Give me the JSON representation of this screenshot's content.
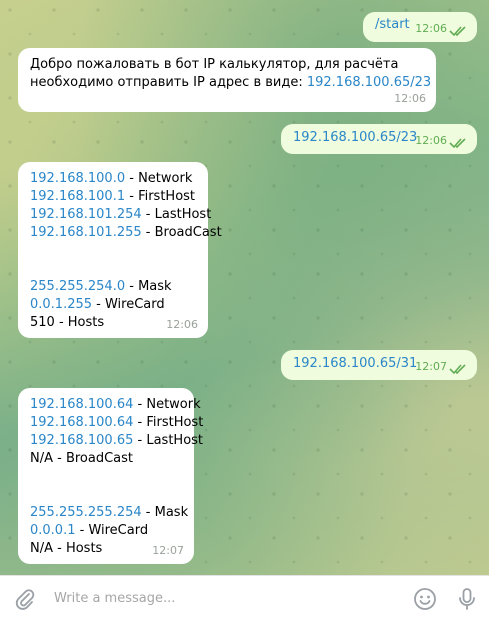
{
  "messages": [
    {
      "dir": "out",
      "lines": [
        [
          "/start",
          "link"
        ]
      ],
      "time": "12:06"
    },
    {
      "dir": "in",
      "lines": [
        [
          "Добро пожаловать в бот IP калькулятор, для расчёта",
          "text"
        ],
        [
          "необходимо отправить IP адрес в виде: ",
          "text",
          "192.168.100.65/23"
        ]
      ],
      "time": "12:06"
    },
    {
      "dir": "out",
      "lines": [
        [
          "192.168.100.65/23",
          "link"
        ]
      ],
      "time": "12:06"
    },
    {
      "dir": "in",
      "rows": [
        {
          "ip": "192.168.100.0",
          "label": " - Network"
        },
        {
          "ip": "192.168.100.1",
          "label": " - FirstHost"
        },
        {
          "ip": "192.168.101.254",
          "label": " - LastHost"
        },
        {
          "ip": "192.168.101.255",
          "label": " - BroadCast"
        },
        {
          "gap": true
        },
        {
          "ip": "255.255.254.0",
          "label": " - Mask"
        },
        {
          "ip": "0.0.1.255",
          "label": " - WireCard"
        },
        {
          "text": "510 - Hosts"
        }
      ],
      "time": "12:06"
    },
    {
      "dir": "out",
      "lines": [
        [
          "192.168.100.65/31",
          "link"
        ]
      ],
      "time": "12:07"
    },
    {
      "dir": "in",
      "rows": [
        {
          "ip": "192.168.100.64",
          "label": " - Network"
        },
        {
          "ip": "192.168.100.64",
          "label": " - FirstHost"
        },
        {
          "ip": "192.168.100.65",
          "label": " - LastHost"
        },
        {
          "text": "N/A - BroadCast"
        },
        {
          "gap": true
        },
        {
          "ip": "255.255.255.254",
          "label": " - Mask"
        },
        {
          "ip": "0.0.0.1",
          "label": " - WireCard"
        },
        {
          "text": "N/A - Hosts"
        }
      ],
      "time": "12:07"
    }
  ],
  "composer": {
    "placeholder": "Write a message..."
  },
  "icons": {
    "attach": "paperclip-icon",
    "emoji": "smiley-icon",
    "voice": "microphone-icon"
  },
  "colors": {
    "link": "#2a86c8",
    "outgoing_bubble": "#effdde",
    "incoming_bubble": "#ffffff",
    "read_check": "#62ac55"
  }
}
